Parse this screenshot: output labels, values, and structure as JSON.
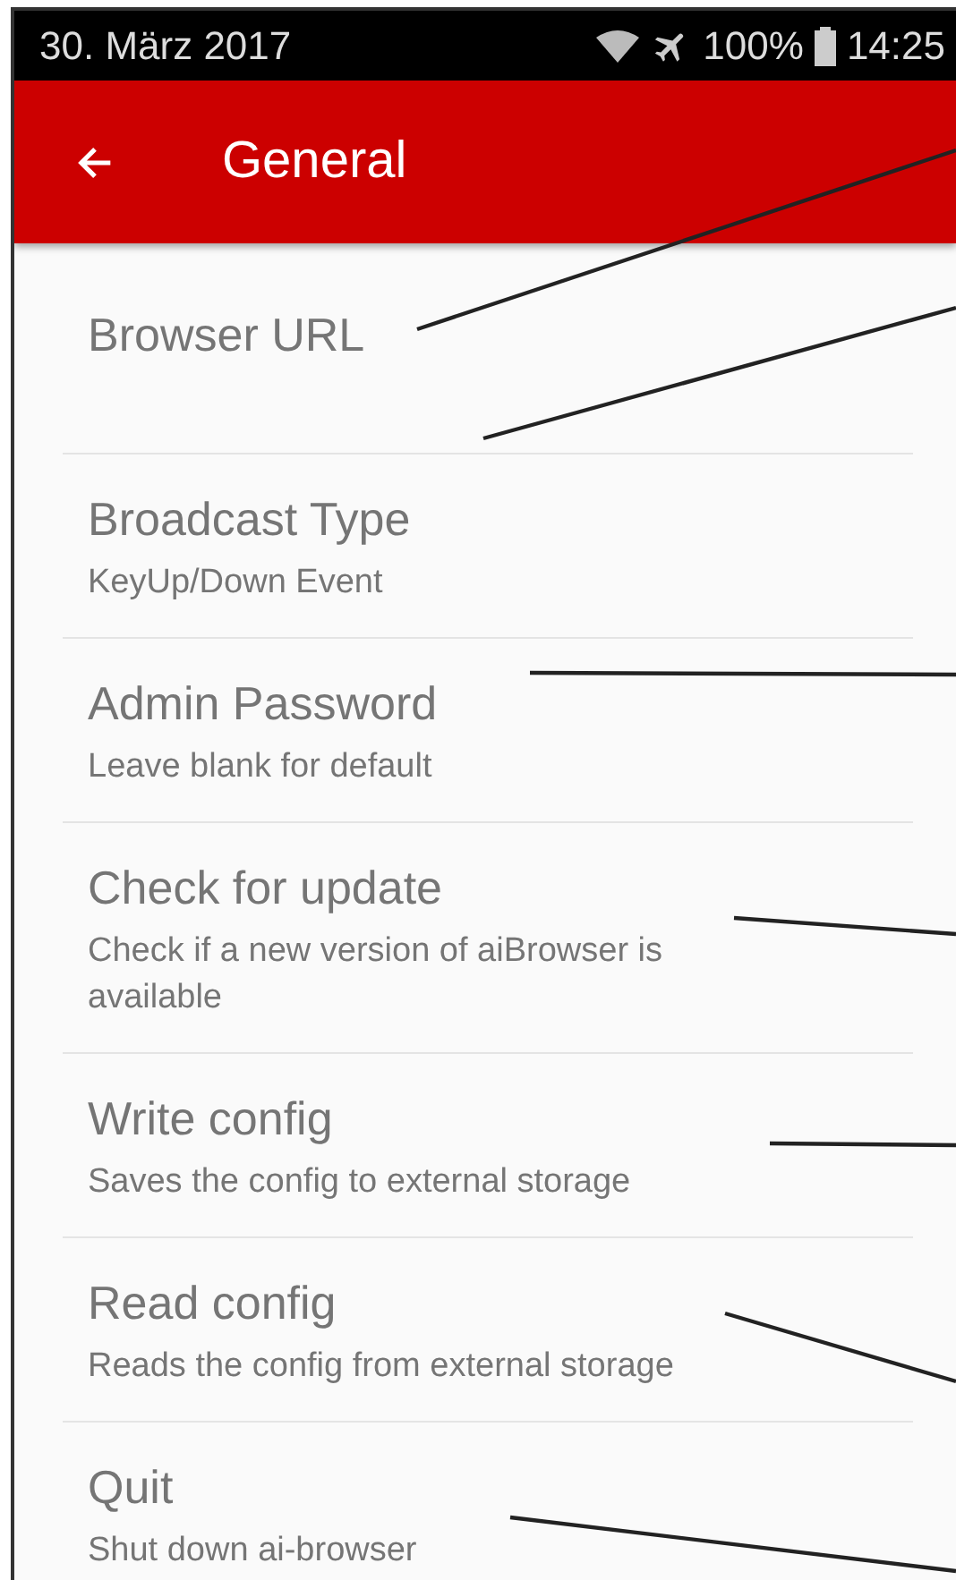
{
  "status_bar": {
    "date": "30. März 2017",
    "battery": "100%",
    "time": "14:25"
  },
  "app_bar": {
    "title": "General"
  },
  "preferences": [
    {
      "title": "Browser URL"
    },
    {
      "title": "Broadcast Type",
      "summary": "KeyUp/Down Event"
    },
    {
      "title": "Admin Password",
      "summary": "Leave blank for default"
    },
    {
      "title": "Check for update",
      "summary": "Check if a new version of aiBrowser is available"
    },
    {
      "title": "Write config",
      "summary": "Saves the config to external storage"
    },
    {
      "title": "Read config",
      "summary": "Reads the config from external storage"
    },
    {
      "title": "Quit",
      "summary": "Shut down ai-browser"
    }
  ]
}
